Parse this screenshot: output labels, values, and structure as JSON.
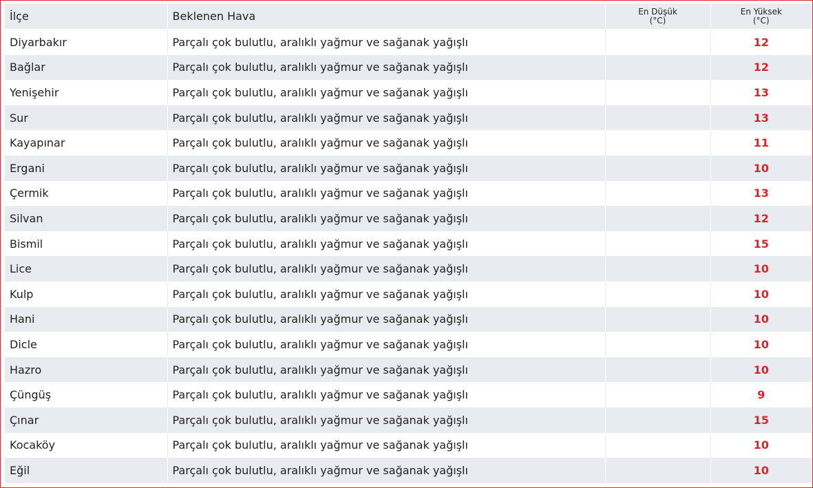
{
  "table": {
    "headers": {
      "district": "İlçe",
      "forecast": "Beklenen Hava",
      "low_line1": "En Düşük",
      "low_line2": "(°C)",
      "high_line1": "En Yüksek",
      "high_line2": "(°C)"
    },
    "rows": [
      {
        "district": "Diyarbakır",
        "forecast": "Parçalı çok bulutlu, aralıklı yağmur ve sağanak yağışlı",
        "low": "",
        "high": "12"
      },
      {
        "district": "Bağlar",
        "forecast": "Parçalı çok bulutlu, aralıklı yağmur ve sağanak yağışlı",
        "low": "",
        "high": "12"
      },
      {
        "district": "Yenişehir",
        "forecast": "Parçalı çok bulutlu, aralıklı yağmur ve sağanak yağışlı",
        "low": "",
        "high": "13"
      },
      {
        "district": "Sur",
        "forecast": "Parçalı çok bulutlu, aralıklı yağmur ve sağanak yağışlı",
        "low": "",
        "high": "13"
      },
      {
        "district": "Kayapınar",
        "forecast": "Parçalı çok bulutlu, aralıklı yağmur ve sağanak yağışlı",
        "low": "",
        "high": "11"
      },
      {
        "district": "Ergani",
        "forecast": "Parçalı çok bulutlu, aralıklı yağmur ve sağanak yağışlı",
        "low": "",
        "high": "10"
      },
      {
        "district": "Çermik",
        "forecast": "Parçalı çok bulutlu, aralıklı yağmur ve sağanak yağışlı",
        "low": "",
        "high": "13"
      },
      {
        "district": "Silvan",
        "forecast": "Parçalı çok bulutlu, aralıklı yağmur ve sağanak yağışlı",
        "low": "",
        "high": "12"
      },
      {
        "district": "Bismil",
        "forecast": "Parçalı çok bulutlu, aralıklı yağmur ve sağanak yağışlı",
        "low": "",
        "high": "15"
      },
      {
        "district": "Lice",
        "forecast": "Parçalı çok bulutlu, aralıklı yağmur ve sağanak yağışlı",
        "low": "",
        "high": "10"
      },
      {
        "district": "Kulp",
        "forecast": "Parçalı çok bulutlu, aralıklı yağmur ve sağanak yağışlı",
        "low": "",
        "high": "10"
      },
      {
        "district": "Hani",
        "forecast": "Parçalı çok bulutlu, aralıklı yağmur ve sağanak yağışlı",
        "low": "",
        "high": "10"
      },
      {
        "district": "Dicle",
        "forecast": "Parçalı çok bulutlu, aralıklı yağmur ve sağanak yağışlı",
        "low": "",
        "high": "10"
      },
      {
        "district": "Hazro",
        "forecast": "Parçalı çok bulutlu, aralıklı yağmur ve sağanak yağışlı",
        "low": "",
        "high": "10"
      },
      {
        "district": "Çüngüş",
        "forecast": "Parçalı çok bulutlu, aralıklı yağmur ve sağanak yağışlı",
        "low": "",
        "high": "9"
      },
      {
        "district": "Çınar",
        "forecast": "Parçalı çok bulutlu, aralıklı yağmur ve sağanak yağışlı",
        "low": "",
        "high": "15"
      },
      {
        "district": "Kocaköy",
        "forecast": "Parçalı çok bulutlu, aralıklı yağmur ve sağanak yağışlı",
        "low": "",
        "high": "10"
      },
      {
        "district": "Eğil",
        "forecast": "Parçalı çok bulutlu, aralıklı yağmur ve sağanak yağışlı",
        "low": "",
        "high": "10"
      }
    ]
  },
  "colors": {
    "border": "#d9262c",
    "stripe": "#e8ecf0",
    "high_temp": "#d9262c"
  }
}
